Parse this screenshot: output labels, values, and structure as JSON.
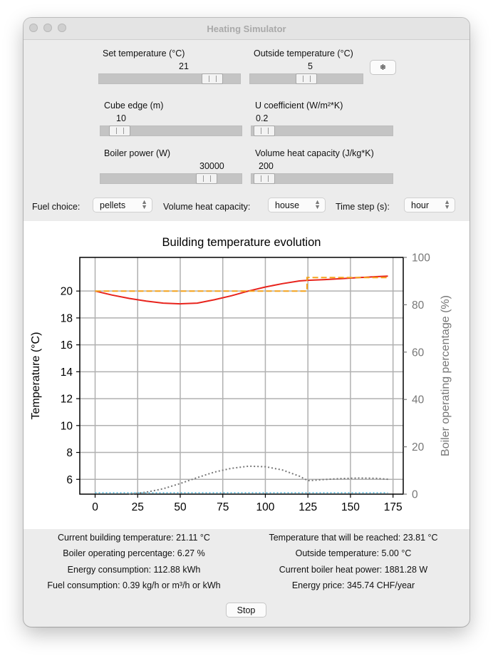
{
  "window": {
    "title": "Heating Simulator"
  },
  "controls": {
    "set_temperature": {
      "label": "Set temperature (°C)",
      "value": "21",
      "fraction": 0.86
    },
    "outside_temperature": {
      "label": "Outside temperature (°C)",
      "value": "5",
      "fraction": 0.5
    },
    "snowflake_button": {
      "icon": "snowflake-icon",
      "glyph": "❄"
    },
    "cube_edge": {
      "label": "Cube edge (m)",
      "value": "10",
      "fraction": 0.07
    },
    "u_coefficient": {
      "label": "U coefficient (W/m²*K)",
      "value": "0.2",
      "fraction": 0.02
    },
    "boiler_power": {
      "label": "Boiler power (W)",
      "value": "30000",
      "fraction": 0.8
    },
    "volume_heat_capacity": {
      "label": "Volume heat capacity (J/kg*K)",
      "value": "200",
      "fraction": 0.02
    }
  },
  "selectors": {
    "fuel": {
      "label": "Fuel choice:",
      "value": "pellets"
    },
    "heat_capacity": {
      "label": "Volume heat capacity:",
      "value": "house"
    },
    "time_step": {
      "label": "Time step (s):",
      "value": "hour"
    }
  },
  "chart_data": {
    "type": "line",
    "title": "Building temperature evolution",
    "xlabel": "",
    "ylabel": "Temperature (°C)",
    "y2label": "Boiler operating percentage (%)",
    "xlim": [
      -9,
      181
    ],
    "ylim": [
      4.9,
      22.5
    ],
    "y2lim": [
      0,
      100
    ],
    "xticks": [
      0,
      25,
      50,
      75,
      100,
      125,
      150,
      175
    ],
    "yticks": [
      6,
      8,
      10,
      12,
      14,
      16,
      18,
      20
    ],
    "y2ticks": [
      0,
      20,
      40,
      60,
      80,
      100
    ],
    "grid": true,
    "series": [
      {
        "color": "#e8231c",
        "style": "solid",
        "axis": "left",
        "x": [
          0,
          10,
          20,
          30,
          40,
          50,
          60,
          70,
          80,
          90,
          100,
          110,
          120,
          125,
          135,
          145,
          155,
          165,
          172
        ],
        "y": [
          20,
          19.7,
          19.45,
          19.25,
          19.1,
          19.05,
          19.1,
          19.35,
          19.65,
          20.0,
          20.3,
          20.55,
          20.75,
          20.8,
          20.85,
          20.92,
          21.0,
          21.07,
          21.11
        ]
      },
      {
        "color": "#f5a31c",
        "style": "dashed",
        "axis": "left",
        "x": [
          0,
          124.5,
          124.5,
          172
        ],
        "y": [
          20,
          20,
          21,
          21
        ]
      },
      {
        "color": "#6fc3e0",
        "style": "dotted",
        "axis": "left",
        "x": [
          0,
          172
        ],
        "y": [
          5,
          5
        ]
      },
      {
        "color": "#777777",
        "style": "dotted",
        "axis": "right",
        "x": [
          20,
          30,
          40,
          50,
          60,
          70,
          80,
          90,
          100,
          110,
          120,
          125,
          135,
          145,
          155,
          165,
          172
        ],
        "y": [
          0,
          0.8,
          2.3,
          4.5,
          7.0,
          9.3,
          10.9,
          11.8,
          11.6,
          10.2,
          7.6,
          5.7,
          6.2,
          6.6,
          6.8,
          6.7,
          6.3
        ]
      }
    ]
  },
  "results": {
    "current_building_temperature": "Current building temperature: 21.11 °C",
    "temperature_reached": "Temperature that will be reached: 23.81 °C",
    "boiler_operating_percentage": "Boiler operating percentage: 6.27 %",
    "outside_temperature": "Outside temperature: 5.00 °C",
    "energy_consumption": "Energy consumption: 112.88 kWh",
    "boiler_heat_power": "Current boiler heat power: 1881.28 W",
    "fuel_consumption": "Fuel consumption: 0.39 kg/h or m³/h or kWh",
    "energy_price": "Energy price: 345.74 CHF/year"
  },
  "stop_button": {
    "label": "Stop"
  }
}
